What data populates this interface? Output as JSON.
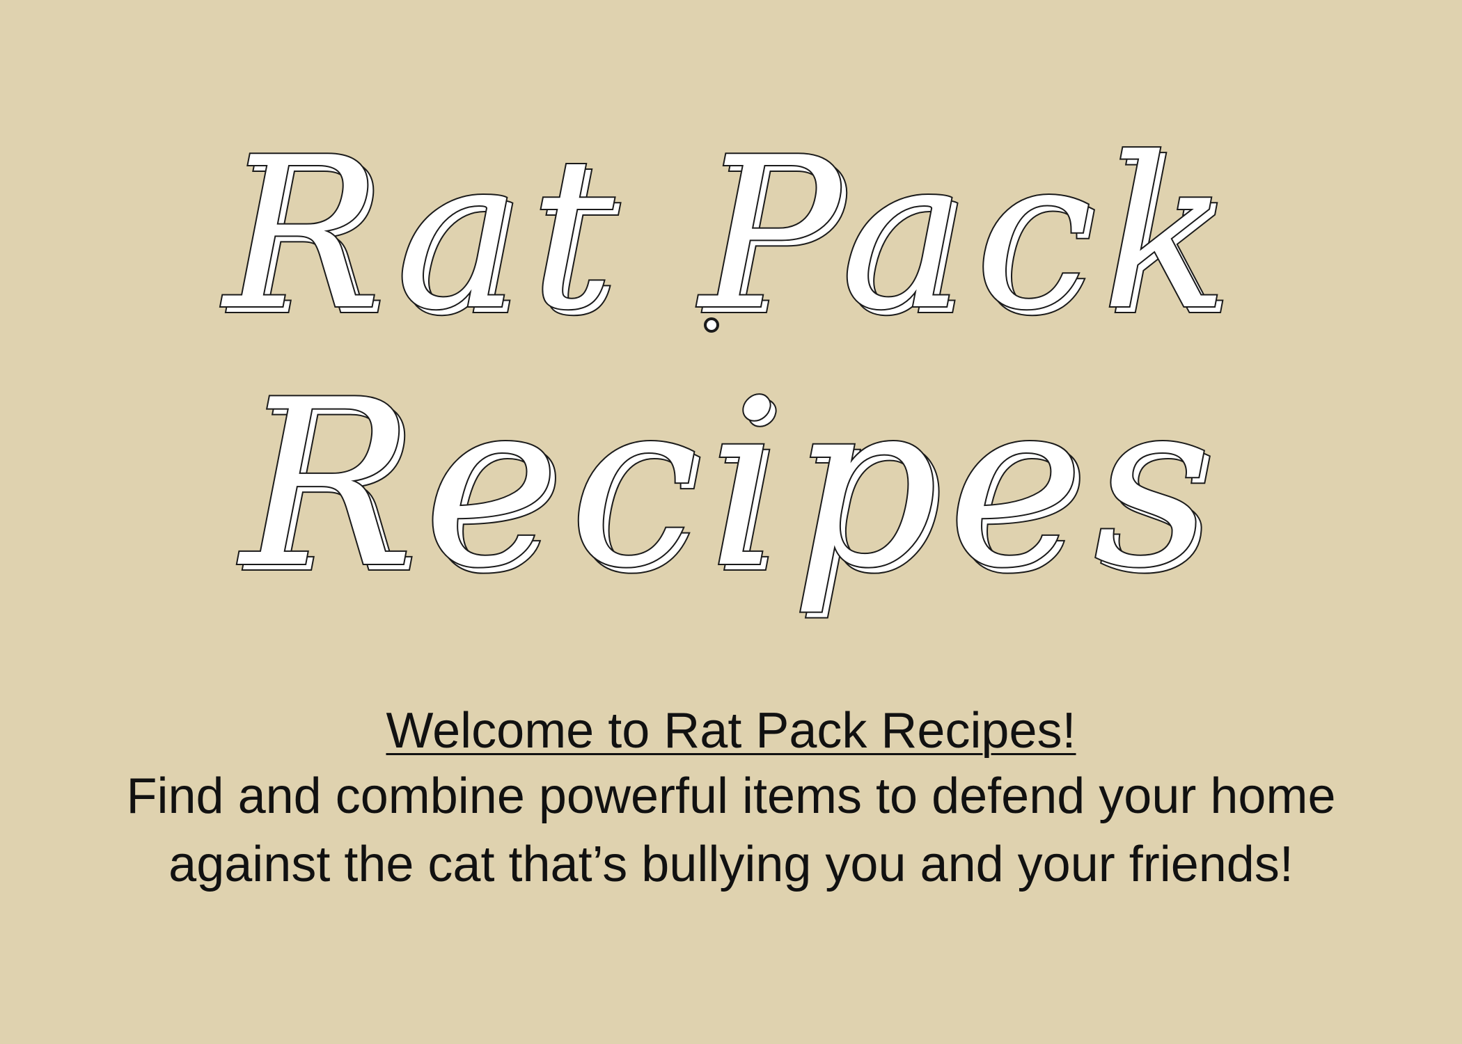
{
  "logo": {
    "line1": "Rat Pack",
    "line2": "Recipes"
  },
  "intro": {
    "welcome": "Welcome to Rat Pack Recipes!",
    "description_line1": "Find and combine powerful items to defend your home",
    "description_line2": "against the cat that’s bullying you and your friends!"
  },
  "colors": {
    "background": "#dfd2af",
    "text": "#111111",
    "logo_fill": "#ffffff",
    "logo_outline": "#1b1b1b"
  }
}
